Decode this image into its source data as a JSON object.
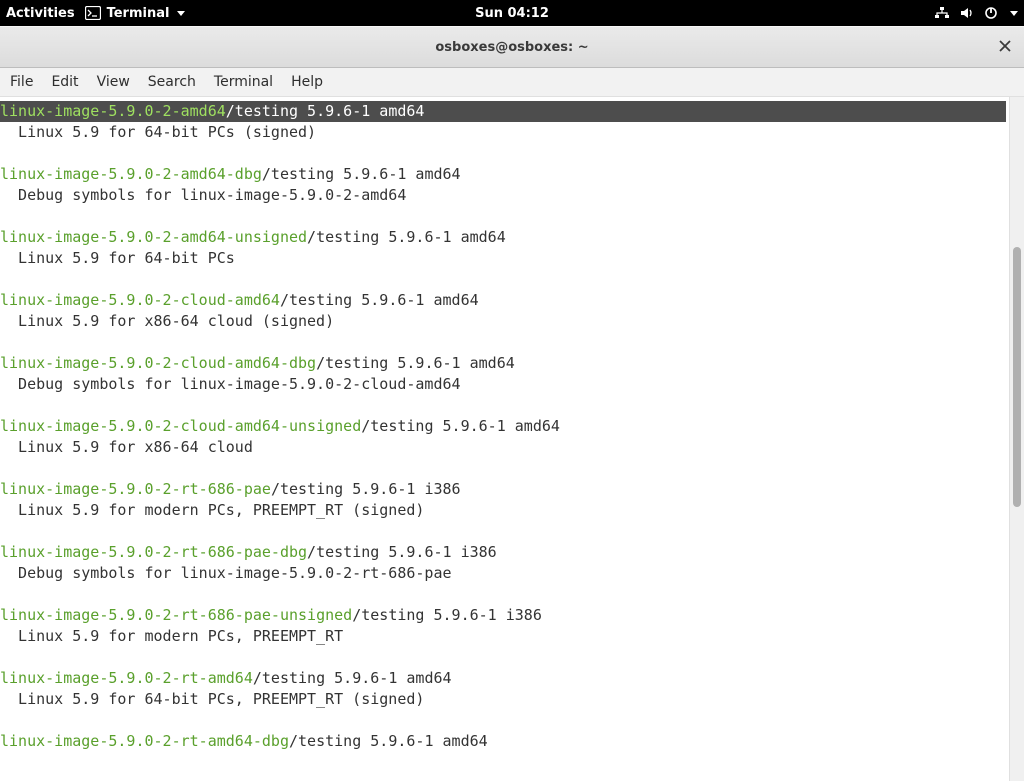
{
  "topbar": {
    "activities": "Activities",
    "appmenu_label": "Terminal",
    "clock": "Sun 04:12"
  },
  "window": {
    "title": "osboxes@osboxes: ~"
  },
  "menubar": {
    "file": "File",
    "edit": "Edit",
    "view": "View",
    "search": "Search",
    "terminal": "Terminal",
    "help": "Help"
  },
  "entries": [
    {
      "pkg": "linux-image-5.9.0-2-amd64",
      "suffix": "/testing 5.9.6-1 amd64",
      "desc": "Linux 5.9 for 64-bit PCs (signed)",
      "highlight": true
    },
    {
      "pkg": "linux-image-5.9.0-2-amd64-dbg",
      "suffix": "/testing 5.9.6-1 amd64",
      "desc": "Debug symbols for linux-image-5.9.0-2-amd64"
    },
    {
      "pkg": "linux-image-5.9.0-2-amd64-unsigned",
      "suffix": "/testing 5.9.6-1 amd64",
      "desc": "Linux 5.9 for 64-bit PCs"
    },
    {
      "pkg": "linux-image-5.9.0-2-cloud-amd64",
      "suffix": "/testing 5.9.6-1 amd64",
      "desc": "Linux 5.9 for x86-64 cloud (signed)"
    },
    {
      "pkg": "linux-image-5.9.0-2-cloud-amd64-dbg",
      "suffix": "/testing 5.9.6-1 amd64",
      "desc": "Debug symbols for linux-image-5.9.0-2-cloud-amd64"
    },
    {
      "pkg": "linux-image-5.9.0-2-cloud-amd64-unsigned",
      "suffix": "/testing 5.9.6-1 amd64",
      "desc": "Linux 5.9 for x86-64 cloud"
    },
    {
      "pkg": "linux-image-5.9.0-2-rt-686-pae",
      "suffix": "/testing 5.9.6-1 i386",
      "desc": "Linux 5.9 for modern PCs, PREEMPT_RT (signed)"
    },
    {
      "pkg": "linux-image-5.9.0-2-rt-686-pae-dbg",
      "suffix": "/testing 5.9.6-1 i386",
      "desc": "Debug symbols for linux-image-5.9.0-2-rt-686-pae"
    },
    {
      "pkg": "linux-image-5.9.0-2-rt-686-pae-unsigned",
      "suffix": "/testing 5.9.6-1 i386",
      "desc": "Linux 5.9 for modern PCs, PREEMPT_RT"
    },
    {
      "pkg": "linux-image-5.9.0-2-rt-amd64",
      "suffix": "/testing 5.9.6-1 amd64",
      "desc": "Linux 5.9 for 64-bit PCs, PREEMPT_RT (signed)"
    },
    {
      "pkg": "linux-image-5.9.0-2-rt-amd64-dbg",
      "suffix": "/testing 5.9.6-1 amd64",
      "desc": ""
    }
  ]
}
